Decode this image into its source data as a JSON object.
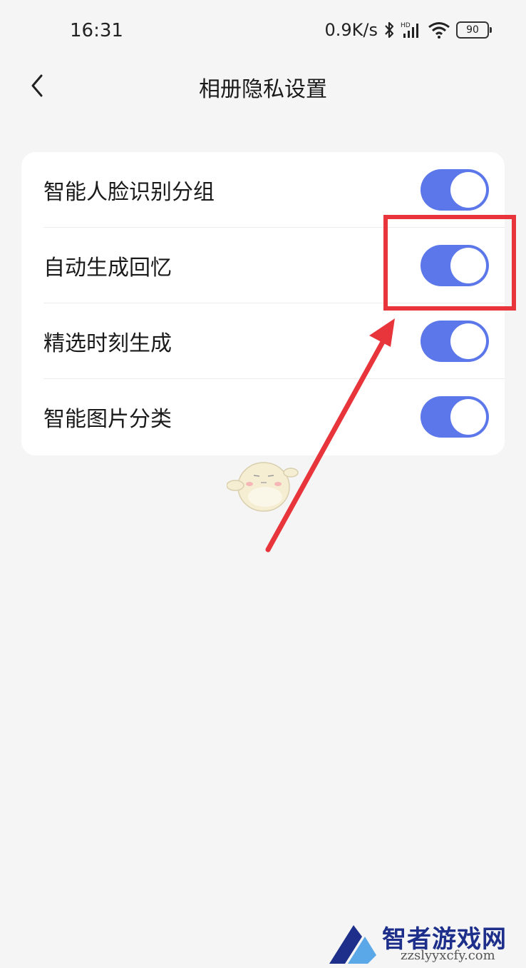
{
  "status_bar": {
    "time": "16:31",
    "network_speed": "0.9K/s",
    "battery": "90",
    "icons": [
      "bluetooth-icon",
      "hd-signal-icon",
      "wifi-icon",
      "battery-icon"
    ]
  },
  "header": {
    "title": "相册隐私设置",
    "back_icon": "chevron-left-icon"
  },
  "settings": [
    {
      "label": "智能人脸识别分组",
      "enabled": true
    },
    {
      "label": "自动生成回忆",
      "enabled": true
    },
    {
      "label": "精选时刻生成",
      "enabled": true
    },
    {
      "label": "智能图片分类",
      "enabled": true
    }
  ],
  "annotation": {
    "highlight_color": "#e8353c"
  },
  "colors": {
    "toggle_on": "#5b77e9",
    "background": "#f5f5f5",
    "card": "#ffffff"
  },
  "watermark": {
    "title": "智者游戏网",
    "url": "zzslyyxcfy.com"
  }
}
